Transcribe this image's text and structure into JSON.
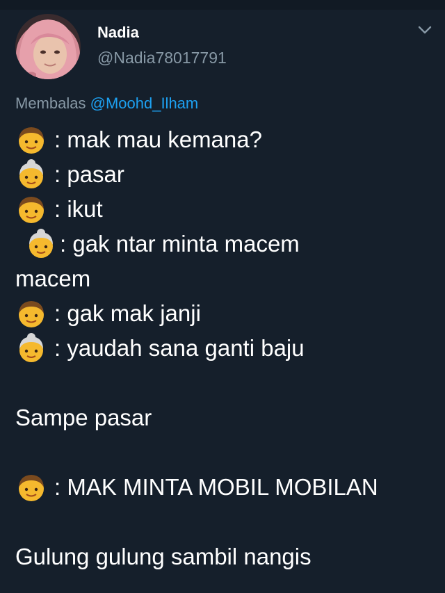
{
  "user": {
    "display_name": "Nadia",
    "handle": "@Nadia78017791"
  },
  "reply": {
    "prefix": "Membalas",
    "mention": "@Moohd_Ilham"
  },
  "tweet": {
    "lines": [
      {
        "speaker": "boy",
        "text": ": mak mau kemana?"
      },
      {
        "speaker": "grandmother",
        "text": ": pasar"
      },
      {
        "speaker": "boy",
        "text": ": ikut"
      },
      {
        "speaker": "grandmother",
        "text": ": gak ntar minta macem"
      },
      {
        "continuation": "macem"
      },
      {
        "speaker": "boy",
        "text": ": gak mak janji"
      },
      {
        "speaker": "grandmother",
        "text": ": yaudah sana ganti baju"
      },
      {
        "paragraph": "Sampe pasar"
      },
      {
        "speaker": "boy",
        "text": ": MAK MINTA MOBIL MOBILAN"
      },
      {
        "paragraph": "Gulung gulung sambil nangis"
      }
    ]
  },
  "icons": {
    "boy": "boy-emoji-icon",
    "grandmother": "older-woman-emoji-icon",
    "menu": "chevron-down-icon"
  },
  "colors": {
    "background": "#151f2b",
    "handle": "#8899a6",
    "mention": "#1da1f2",
    "text": "#ffffff"
  }
}
